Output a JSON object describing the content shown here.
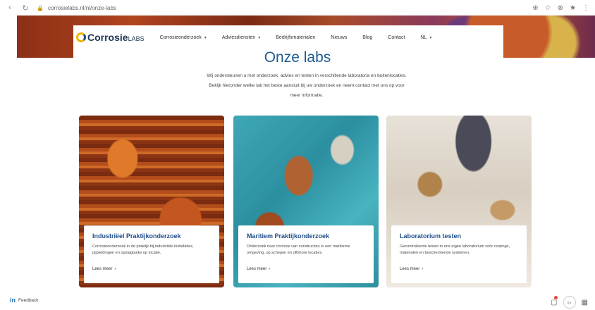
{
  "browser": {
    "back": "‹",
    "reload": "↻",
    "url": "corrosielabs.nl/nl/onze-labs",
    "icons": [
      "⊕",
      "☆",
      "⊗",
      "★",
      "⋮"
    ]
  },
  "brand": {
    "name": "Corrosie",
    "suffix": "LABS"
  },
  "nav": {
    "items": [
      {
        "label": "Corrosieonderzoek",
        "has_dropdown": true
      },
      {
        "label": "Adviesdiensten",
        "has_dropdown": true
      },
      {
        "label": "Bedrijfsmaterialen",
        "has_dropdown": false
      },
      {
        "label": "Nieuws",
        "has_dropdown": false
      },
      {
        "label": "Blog",
        "has_dropdown": false
      },
      {
        "label": "Contact",
        "has_dropdown": false
      },
      {
        "label": "NL",
        "has_dropdown": true
      }
    ]
  },
  "page": {
    "title": "Onze labs",
    "intro": "Wij ondersteunen u met onderzoek, advies en testen in verschillende laboratoria en buitenlocaties. Bekijk hieronder welke lab het beste aansluit bij uw onderzoek en neem contact met ons op voor meer informatie."
  },
  "cards": [
    {
      "title": "Industriëel Praktijkonderzoek",
      "text": "Corrosieonderzoek in de praktijk bij industriële installaties, pijpleidingen en opslagtanks op locatie.",
      "link": "Lees meer",
      "arrow": "›"
    },
    {
      "title": "Maritiem Praktijkonderzoek",
      "text": "Onderzoek naar corrosie van constructies in een maritieme omgeving, op schepen en offshore locaties.",
      "link": "Lees meer",
      "arrow": "›"
    },
    {
      "title": "Laboratorium testen",
      "text": "Gecontroleerde testen in ons eigen laboratorium voor coatings, materialen en beschermende systemen.",
      "link": "Lees meer",
      "arrow": "›"
    }
  ],
  "footer_overlay": {
    "left_label": "Feedback",
    "left_icon": "in"
  }
}
